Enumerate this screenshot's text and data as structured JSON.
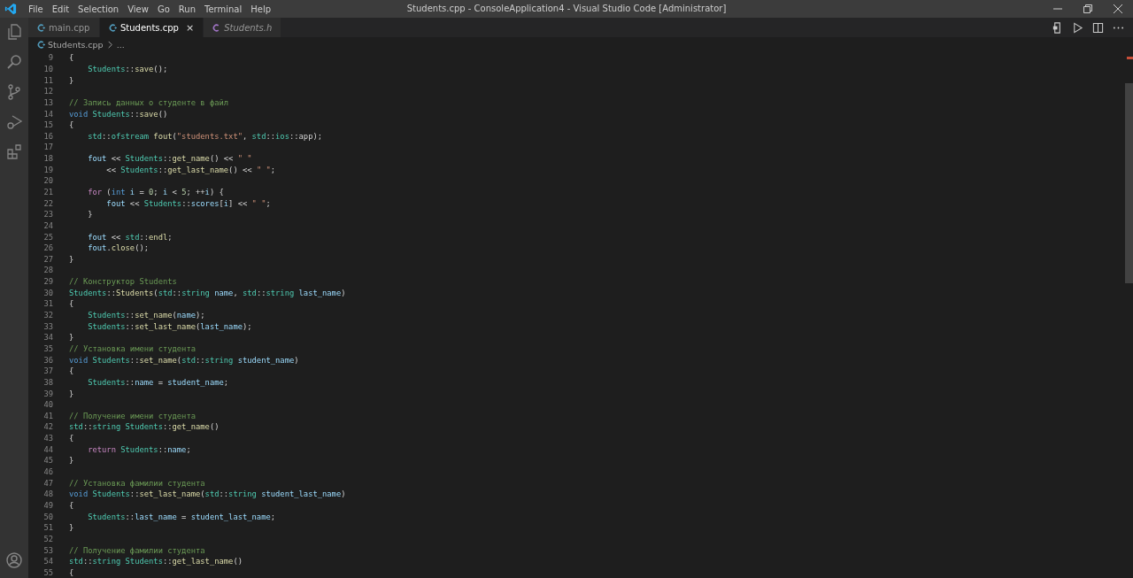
{
  "window": {
    "title": "Students.cpp - ConsoleApplication4 - Visual Studio Code [Administrator]"
  },
  "menu": [
    "File",
    "Edit",
    "Selection",
    "View",
    "Go",
    "Run",
    "Terminal",
    "Help"
  ],
  "tabs": [
    {
      "label": "main.cpp",
      "kind": "cpp",
      "selected": false,
      "preview": false
    },
    {
      "label": "Students.cpp",
      "kind": "cpp",
      "selected": true,
      "preview": false,
      "close": "×"
    },
    {
      "label": "Students.h",
      "kind": "header",
      "selected": false,
      "preview": true
    }
  ],
  "breadcrumb": [
    "Students.cpp",
    "..."
  ],
  "code": [
    {
      "number": "9",
      "tokens": [
        {
          "kind": "plain",
          "text": "{"
        }
      ]
    },
    {
      "number": "10",
      "tokens": [
        {
          "kind": "type",
          "text": "    Students"
        },
        {
          "kind": "plain",
          "text": "::"
        },
        {
          "kind": "function",
          "text": "save"
        },
        {
          "kind": "plain",
          "text": "();"
        }
      ]
    },
    {
      "number": "11",
      "tokens": [
        {
          "kind": "plain",
          "text": "}"
        }
      ]
    },
    {
      "number": "12"
    },
    {
      "number": "13",
      "tokens": [
        {
          "kind": "comment",
          "text": "// Запись данных о студенте в файл"
        }
      ]
    },
    {
      "number": "14",
      "tokens": [
        {
          "kind": "keyword",
          "text": "void"
        },
        {
          "kind": "type",
          "text": " Students"
        },
        {
          "kind": "plain",
          "text": "::"
        },
        {
          "kind": "function",
          "text": "save"
        },
        {
          "kind": "plain",
          "text": "()"
        }
      ]
    },
    {
      "number": "15",
      "tokens": [
        {
          "kind": "plain",
          "text": "{"
        }
      ]
    },
    {
      "number": "16",
      "tokens": [
        {
          "kind": "type",
          "text": "    std"
        },
        {
          "kind": "plain",
          "text": "::"
        },
        {
          "kind": "type",
          "text": "ofstream"
        },
        {
          "kind": "function",
          "text": " fout"
        },
        {
          "kind": "plain",
          "text": "("
        },
        {
          "kind": "string",
          "text": "\"students.txt\""
        },
        {
          "kind": "plain",
          "text": ", "
        },
        {
          "kind": "type",
          "text": "std"
        },
        {
          "kind": "plain",
          "text": "::"
        },
        {
          "kind": "type",
          "text": "ios"
        },
        {
          "kind": "plain",
          "text": "::app);"
        }
      ]
    },
    {
      "number": "17"
    },
    {
      "number": "18",
      "tokens": [
        {
          "kind": "variable",
          "text": "    fout"
        },
        {
          "kind": "plain",
          "text": " << "
        },
        {
          "kind": "type",
          "text": "Students"
        },
        {
          "kind": "plain",
          "text": "::"
        },
        {
          "kind": "function",
          "text": "get_name"
        },
        {
          "kind": "plain",
          "text": "() << "
        },
        {
          "kind": "string",
          "text": "\" \""
        }
      ]
    },
    {
      "number": "19",
      "tokens": [
        {
          "kind": "plain",
          "text": "        << "
        },
        {
          "kind": "type",
          "text": "Students"
        },
        {
          "kind": "plain",
          "text": "::"
        },
        {
          "kind": "function",
          "text": "get_last_name"
        },
        {
          "kind": "plain",
          "text": "() << "
        },
        {
          "kind": "string",
          "text": "\" \""
        },
        {
          "kind": "plain",
          "text": ";"
        }
      ]
    },
    {
      "number": "20"
    },
    {
      "number": "21",
      "tokens": [
        {
          "kind": "control",
          "text": "    for"
        },
        {
          "kind": "plain",
          "text": " ("
        },
        {
          "kind": "keyword",
          "text": "int"
        },
        {
          "kind": "variable",
          "text": " i"
        },
        {
          "kind": "plain",
          "text": " = "
        },
        {
          "kind": "number",
          "text": "0"
        },
        {
          "kind": "plain",
          "text": "; "
        },
        {
          "kind": "variable",
          "text": "i"
        },
        {
          "kind": "plain",
          "text": " < "
        },
        {
          "kind": "number",
          "text": "5"
        },
        {
          "kind": "plain",
          "text": "; ++"
        },
        {
          "kind": "variable",
          "text": "i"
        },
        {
          "kind": "plain",
          "text": ") {"
        }
      ]
    },
    {
      "number": "22",
      "tokens": [
        {
          "kind": "variable",
          "text": "        fout"
        },
        {
          "kind": "plain",
          "text": " << "
        },
        {
          "kind": "type",
          "text": "Students"
        },
        {
          "kind": "plain",
          "text": "::"
        },
        {
          "kind": "variable",
          "text": "scores"
        },
        {
          "kind": "plain",
          "text": "["
        },
        {
          "kind": "variable",
          "text": "i"
        },
        {
          "kind": "plain",
          "text": "] << "
        },
        {
          "kind": "string",
          "text": "\" \""
        },
        {
          "kind": "plain",
          "text": ";"
        }
      ]
    },
    {
      "number": "23",
      "tokens": [
        {
          "kind": "plain",
          "text": "    }"
        }
      ]
    },
    {
      "number": "24"
    },
    {
      "number": "25",
      "tokens": [
        {
          "kind": "variable",
          "text": "    fout"
        },
        {
          "kind": "plain",
          "text": " << "
        },
        {
          "kind": "type",
          "text": "std"
        },
        {
          "kind": "plain",
          "text": "::"
        },
        {
          "kind": "function",
          "text": "endl"
        },
        {
          "kind": "plain",
          "text": ";"
        }
      ]
    },
    {
      "number": "26",
      "tokens": [
        {
          "kind": "variable",
          "text": "    fout"
        },
        {
          "kind": "plain",
          "text": "."
        },
        {
          "kind": "function",
          "text": "close"
        },
        {
          "kind": "plain",
          "text": "();"
        }
      ]
    },
    {
      "number": "27",
      "tokens": [
        {
          "kind": "plain",
          "text": "}"
        }
      ]
    },
    {
      "number": "28"
    },
    {
      "number": "29",
      "tokens": [
        {
          "kind": "comment",
          "text": "// Конструктор Students"
        }
      ]
    },
    {
      "number": "30",
      "tokens": [
        {
          "kind": "type",
          "text": "Students"
        },
        {
          "kind": "plain",
          "text": "::"
        },
        {
          "kind": "function",
          "text": "Students"
        },
        {
          "kind": "plain",
          "text": "("
        },
        {
          "kind": "type",
          "text": "std"
        },
        {
          "kind": "plain",
          "text": "::"
        },
        {
          "kind": "type",
          "text": "string"
        },
        {
          "kind": "variable",
          "text": " name"
        },
        {
          "kind": "plain",
          "text": ", "
        },
        {
          "kind": "type",
          "text": "std"
        },
        {
          "kind": "plain",
          "text": "::"
        },
        {
          "kind": "type",
          "text": "string"
        },
        {
          "kind": "variable",
          "text": " last_name"
        },
        {
          "kind": "plain",
          "text": ")"
        }
      ]
    },
    {
      "number": "31",
      "tokens": [
        {
          "kind": "plain",
          "text": "{"
        }
      ]
    },
    {
      "number": "32",
      "tokens": [
        {
          "kind": "type",
          "text": "    Students"
        },
        {
          "kind": "plain",
          "text": "::"
        },
        {
          "kind": "function",
          "text": "set_name"
        },
        {
          "kind": "plain",
          "text": "("
        },
        {
          "kind": "variable",
          "text": "name"
        },
        {
          "kind": "plain",
          "text": ");"
        }
      ]
    },
    {
      "number": "33",
      "tokens": [
        {
          "kind": "type",
          "text": "    Students"
        },
        {
          "kind": "plain",
          "text": "::"
        },
        {
          "kind": "function",
          "text": "set_last_name"
        },
        {
          "kind": "plain",
          "text": "("
        },
        {
          "kind": "variable",
          "text": "last_name"
        },
        {
          "kind": "plain",
          "text": ");"
        }
      ]
    },
    {
      "number": "34",
      "tokens": [
        {
          "kind": "plain",
          "text": "}"
        }
      ]
    },
    {
      "number": "35",
      "tokens": [
        {
          "kind": "comment",
          "text": "// Установка имени студента"
        }
      ]
    },
    {
      "number": "36",
      "tokens": [
        {
          "kind": "keyword",
          "text": "void"
        },
        {
          "kind": "type",
          "text": " Students"
        },
        {
          "kind": "plain",
          "text": "::"
        },
        {
          "kind": "function",
          "text": "set_name"
        },
        {
          "kind": "plain",
          "text": "("
        },
        {
          "kind": "type",
          "text": "std"
        },
        {
          "kind": "plain",
          "text": "::"
        },
        {
          "kind": "type",
          "text": "string"
        },
        {
          "kind": "variable",
          "text": " student_name"
        },
        {
          "kind": "plain",
          "text": ")"
        }
      ]
    },
    {
      "number": "37",
      "tokens": [
        {
          "kind": "plain",
          "text": "{"
        }
      ]
    },
    {
      "number": "38",
      "tokens": [
        {
          "kind": "type",
          "text": "    Students"
        },
        {
          "kind": "plain",
          "text": "::"
        },
        {
          "kind": "variable",
          "text": "name"
        },
        {
          "kind": "plain",
          "text": " = "
        },
        {
          "kind": "variable",
          "text": "student_name"
        },
        {
          "kind": "plain",
          "text": ";"
        }
      ]
    },
    {
      "number": "39",
      "tokens": [
        {
          "kind": "plain",
          "text": "}"
        }
      ]
    },
    {
      "number": "40"
    },
    {
      "number": "41",
      "tokens": [
        {
          "kind": "comment",
          "text": "// Получение имени студента"
        }
      ]
    },
    {
      "number": "42",
      "tokens": [
        {
          "kind": "type",
          "text": "std"
        },
        {
          "kind": "plain",
          "text": "::"
        },
        {
          "kind": "type",
          "text": "string"
        },
        {
          "kind": "type",
          "text": " Students"
        },
        {
          "kind": "plain",
          "text": "::"
        },
        {
          "kind": "function",
          "text": "get_name"
        },
        {
          "kind": "plain",
          "text": "()"
        }
      ]
    },
    {
      "number": "43",
      "tokens": [
        {
          "kind": "plain",
          "text": "{"
        }
      ]
    },
    {
      "number": "44",
      "tokens": [
        {
          "kind": "control",
          "text": "    return"
        },
        {
          "kind": "type",
          "text": " Students"
        },
        {
          "kind": "plain",
          "text": "::"
        },
        {
          "kind": "variable",
          "text": "name"
        },
        {
          "kind": "plain",
          "text": ";"
        }
      ]
    },
    {
      "number": "45",
      "tokens": [
        {
          "kind": "plain",
          "text": "}"
        }
      ]
    },
    {
      "number": "46"
    },
    {
      "number": "47",
      "tokens": [
        {
          "kind": "comment",
          "text": "// Установка фамилии студента"
        }
      ]
    },
    {
      "number": "48",
      "tokens": [
        {
          "kind": "keyword",
          "text": "void"
        },
        {
          "kind": "type",
          "text": " Students"
        },
        {
          "kind": "plain",
          "text": "::"
        },
        {
          "kind": "function",
          "text": "set_last_name"
        },
        {
          "kind": "plain",
          "text": "("
        },
        {
          "kind": "type",
          "text": "std"
        },
        {
          "kind": "plain",
          "text": "::"
        },
        {
          "kind": "type",
          "text": "string"
        },
        {
          "kind": "variable",
          "text": " student_last_name"
        },
        {
          "kind": "plain",
          "text": ")"
        }
      ]
    },
    {
      "number": "49",
      "tokens": [
        {
          "kind": "plain",
          "text": "{"
        }
      ]
    },
    {
      "number": "50",
      "tokens": [
        {
          "kind": "type",
          "text": "    Students"
        },
        {
          "kind": "plain",
          "text": "::"
        },
        {
          "kind": "variable",
          "text": "last_name"
        },
        {
          "kind": "plain",
          "text": " = "
        },
        {
          "kind": "variable",
          "text": "student_last_name"
        },
        {
          "kind": "plain",
          "text": ";"
        }
      ]
    },
    {
      "number": "51",
      "tokens": [
        {
          "kind": "plain",
          "text": "}"
        }
      ]
    },
    {
      "number": "52"
    },
    {
      "number": "53",
      "tokens": [
        {
          "kind": "comment",
          "text": "// Получение фамилии студента"
        }
      ]
    },
    {
      "number": "54",
      "tokens": [
        {
          "kind": "type",
          "text": "std"
        },
        {
          "kind": "plain",
          "text": "::"
        },
        {
          "kind": "type",
          "text": "string"
        },
        {
          "kind": "type",
          "text": " Students"
        },
        {
          "kind": "plain",
          "text": "::"
        },
        {
          "kind": "function",
          "text": "get_last_name"
        },
        {
          "kind": "plain",
          "text": "()"
        }
      ]
    },
    {
      "number": "55",
      "tokens": [
        {
          "kind": "plain",
          "text": "{"
        }
      ]
    }
  ]
}
